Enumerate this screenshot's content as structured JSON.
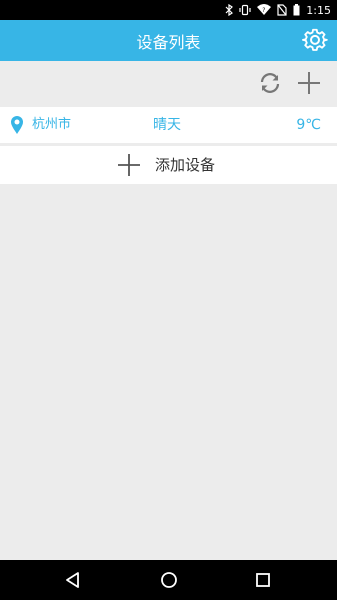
{
  "status_bar": {
    "time": "1:15",
    "icons": [
      "bluetooth-icon",
      "vibrate-icon",
      "wifi-icon",
      "no-sim-icon",
      "battery-icon"
    ]
  },
  "header": {
    "title": "设备列表",
    "settings_icon": "gear-icon"
  },
  "toolbar": {
    "refresh_icon": "refresh-icon",
    "add_icon": "plus-icon"
  },
  "weather": {
    "city": "杭州市",
    "condition": "晴天",
    "temperature": "9℃"
  },
  "add_device": {
    "label": "添加设备"
  },
  "nav_bar": {
    "icons": [
      "back-icon",
      "home-icon",
      "recents-icon"
    ]
  },
  "colors": {
    "accent": "#37b5e6",
    "background": "#ececec"
  }
}
